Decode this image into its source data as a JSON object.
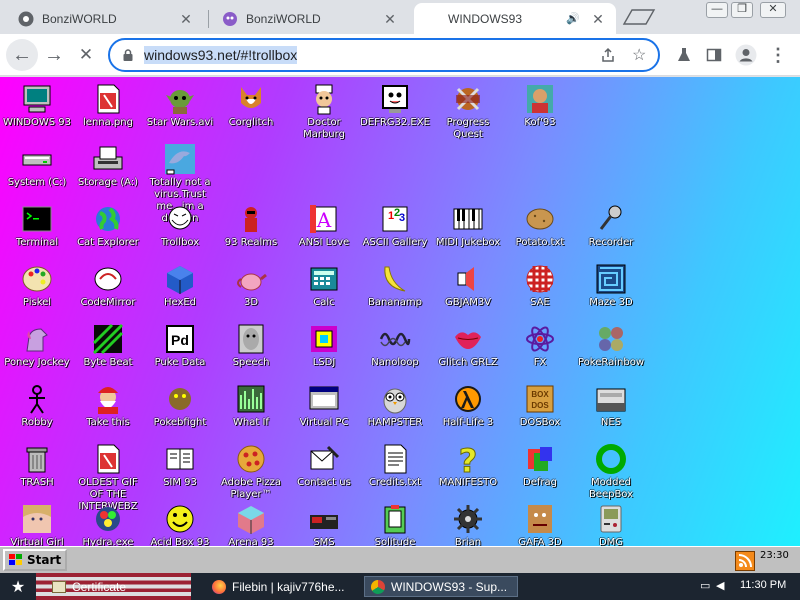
{
  "browser": {
    "tabs": [
      {
        "title": "BonziWORLD",
        "active": false,
        "favicon": "chrome-icon"
      },
      {
        "title": "BonziWORLD",
        "active": false,
        "favicon": "bonzi-icon"
      },
      {
        "title": "WINDOWS93",
        "active": true,
        "favicon": "none",
        "audio": true
      }
    ],
    "url": "windows93.net/#!trollbox",
    "nav": {
      "back": "←",
      "forward": "→",
      "stop": "✕"
    }
  },
  "desktop": {
    "icons": [
      {
        "label": "WINDOWS 93",
        "icon": "computer-icon",
        "col": 0,
        "row": 0
      },
      {
        "label": "lenna.png",
        "icon": "image-file-icon",
        "col": 1,
        "row": 0
      },
      {
        "label": "Star Wars.avi",
        "icon": "yoda-icon",
        "col": 2,
        "row": 0
      },
      {
        "label": "Corglitch",
        "icon": "corgi-icon",
        "col": 3,
        "row": 0
      },
      {
        "label": "Doctor Marburg",
        "icon": "doctor-icon",
        "col": 4,
        "row": 0
      },
      {
        "label": "DEFRG32.EXE",
        "icon": "defrag-face-icon",
        "col": 5,
        "row": 0
      },
      {
        "label": "Progress Quest",
        "icon": "swords-icon",
        "col": 6,
        "row": 0
      },
      {
        "label": "Kof'93",
        "icon": "fighter-icon",
        "col": 7,
        "row": 0
      },
      {
        "label": "System (C:)",
        "icon": "drive-icon",
        "col": 0,
        "row": 1
      },
      {
        "label": "Storage (A:)",
        "icon": "floppy-drive-icon",
        "col": 1,
        "row": 1
      },
      {
        "label": "Totally not a virus.Trust me...im a dolphin",
        "icon": "dolphin-icon",
        "col": 2,
        "row": 1
      },
      {
        "label": "Terminal",
        "icon": "terminal-icon",
        "col": 0,
        "row": 2
      },
      {
        "label": "Cat Explorer",
        "icon": "globe-icon",
        "col": 1,
        "row": 2
      },
      {
        "label": "Trollbox",
        "icon": "troll-icon",
        "col": 2,
        "row": 2
      },
      {
        "label": "93 Realms",
        "icon": "knight-icon",
        "col": 3,
        "row": 2
      },
      {
        "label": "ANSI Love",
        "icon": "ansi-icon",
        "col": 4,
        "row": 2
      },
      {
        "label": "ASCII Gallery",
        "icon": "ascii-icon",
        "col": 5,
        "row": 2
      },
      {
        "label": "MIDI Jukebox",
        "icon": "piano-icon",
        "col": 6,
        "row": 2
      },
      {
        "label": "Potato.txt",
        "icon": "potato-icon",
        "col": 7,
        "row": 2
      },
      {
        "label": "Recorder",
        "icon": "microphone-icon",
        "col": 8,
        "row": 2
      },
      {
        "label": "Piskel",
        "icon": "palette-icon",
        "col": 0,
        "row": 3
      },
      {
        "label": "CodeMirror",
        "icon": "codemirror-icon",
        "col": 1,
        "row": 3
      },
      {
        "label": "HexEd",
        "icon": "cube-icon",
        "col": 2,
        "row": 3
      },
      {
        "label": "3D",
        "icon": "teapot-icon",
        "col": 3,
        "row": 3
      },
      {
        "label": "Calc",
        "icon": "calculator-icon",
        "col": 4,
        "row": 3
      },
      {
        "label": "Bananamp",
        "icon": "banana-icon",
        "col": 5,
        "row": 3
      },
      {
        "label": "GBJAM3V",
        "icon": "speaker-icon",
        "col": 6,
        "row": 3
      },
      {
        "label": "SAE",
        "icon": "amiga-ball-icon",
        "col": 7,
        "row": 3
      },
      {
        "label": "Maze 3D",
        "icon": "maze-icon",
        "col": 8,
        "row": 3
      },
      {
        "label": "Poney Jockey",
        "icon": "pony-icon",
        "col": 0,
        "row": 4
      },
      {
        "label": "Byte Beat",
        "icon": "bytebeat-icon",
        "col": 1,
        "row": 4
      },
      {
        "label": "Puke Data",
        "icon": "pd-icon",
        "col": 2,
        "row": 4
      },
      {
        "label": "Speech",
        "icon": "face-icon",
        "col": 3,
        "row": 4
      },
      {
        "label": "LSDJ",
        "icon": "lsdj-icon",
        "col": 4,
        "row": 4
      },
      {
        "label": "Nanoloop",
        "icon": "wave-icon",
        "col": 5,
        "row": 4
      },
      {
        "label": "Glitch GRLZ",
        "icon": "lips-icon",
        "col": 6,
        "row": 4
      },
      {
        "label": "FX",
        "icon": "atom-icon",
        "col": 7,
        "row": 4
      },
      {
        "label": "PokeRainbow",
        "icon": "pokerainbow-icon",
        "col": 8,
        "row": 4
      },
      {
        "label": "Robby",
        "icon": "stickman-icon",
        "col": 0,
        "row": 5
      },
      {
        "label": "Take this",
        "icon": "santa-icon",
        "col": 1,
        "row": 5
      },
      {
        "label": "Pokebfight",
        "icon": "pokefight-icon",
        "col": 2,
        "row": 5
      },
      {
        "label": "What If",
        "icon": "whatif-icon",
        "col": 3,
        "row": 5
      },
      {
        "label": "Virtual PC",
        "icon": "virtual-pc-icon",
        "col": 4,
        "row": 5
      },
      {
        "label": "HAMPSTER",
        "icon": "owl-icon",
        "col": 5,
        "row": 5
      },
      {
        "label": "Half-Life 3",
        "icon": "lambda-icon",
        "col": 6,
        "row": 5
      },
      {
        "label": "DOSBox",
        "icon": "dosbox-icon",
        "col": 7,
        "row": 5
      },
      {
        "label": "NES",
        "icon": "nes-icon",
        "col": 8,
        "row": 5
      },
      {
        "label": "TRASH",
        "icon": "trash-icon",
        "col": 0,
        "row": 6
      },
      {
        "label": "OLDEST GIF OF THE INTERWEBZ",
        "icon": "gif-file-icon",
        "col": 1,
        "row": 6
      },
      {
        "label": "SIM 93",
        "icon": "book-icon",
        "col": 2,
        "row": 6
      },
      {
        "label": "Adobe Pizza Player™",
        "icon": "pizza-icon",
        "col": 3,
        "row": 6
      },
      {
        "label": "Contact us",
        "icon": "contact-icon",
        "col": 4,
        "row": 6
      },
      {
        "label": "Credits.txt",
        "icon": "text-file-icon",
        "col": 5,
        "row": 6
      },
      {
        "label": "MANIFESTO",
        "icon": "question-icon",
        "col": 6,
        "row": 6
      },
      {
        "label": "Defrag",
        "icon": "defrag-icon",
        "col": 7,
        "row": 6
      },
      {
        "label": "Modded BeepBox",
        "icon": "beepbox-icon",
        "col": 8,
        "row": 6
      },
      {
        "label": "Virtual Girl",
        "icon": "girl-icon",
        "col": 0,
        "row": 7
      },
      {
        "label": "Hydra.exe",
        "icon": "hydra-icon",
        "col": 1,
        "row": 7
      },
      {
        "label": "Acid Box 93",
        "icon": "smiley-icon",
        "col": 2,
        "row": 7
      },
      {
        "label": "Arena 93",
        "icon": "arena-icon",
        "col": 3,
        "row": 7
      },
      {
        "label": "SMS",
        "icon": "sms-icon",
        "col": 4,
        "row": 7
      },
      {
        "label": "Solitude",
        "icon": "solitude-icon",
        "col": 5,
        "row": 7
      },
      {
        "label": "Brian",
        "icon": "gear-icon",
        "col": 6,
        "row": 7
      },
      {
        "label": "GAFA 3D",
        "icon": "doomguy-icon",
        "col": 7,
        "row": 7
      },
      {
        "label": "DMG",
        "icon": "gameboy-icon",
        "col": 8,
        "row": 7
      }
    ]
  },
  "w93taskbar": {
    "start_label": "Start",
    "clock": "23:30"
  },
  "ostaskbar": {
    "tasks": [
      {
        "label": "Certificate",
        "active": false
      },
      {
        "label": "Filebin | kajiv776he...",
        "active": false
      },
      {
        "label": "WINDOWS93 - Sup...",
        "active": true
      }
    ],
    "clock": "11:30 PM"
  },
  "colors": {
    "desktop_gradient_start": "#ff00ff",
    "desktop_gradient_end": "#1ef0ff",
    "omnibox_focus": "#1a73e8"
  }
}
